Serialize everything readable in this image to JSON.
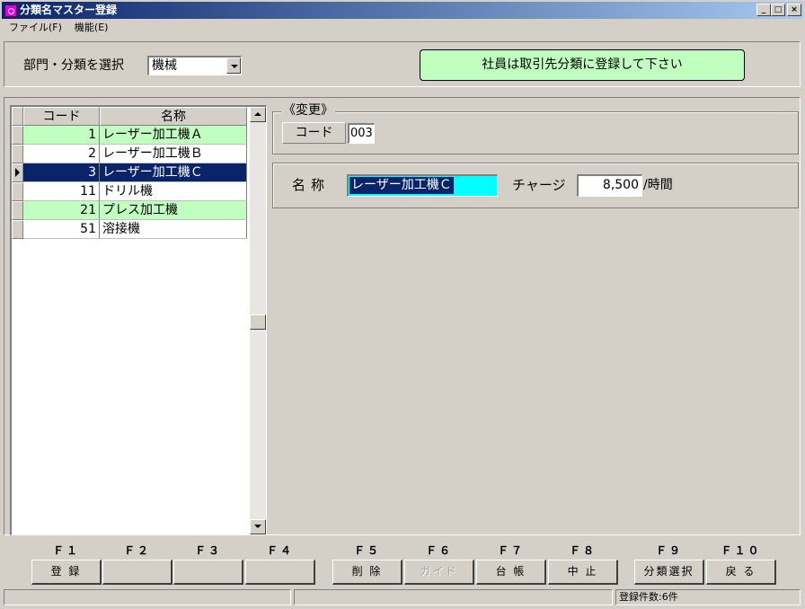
{
  "window": {
    "title": "分類名マスター登録",
    "controls": {
      "minimize": "_",
      "maximize": "□",
      "close": "×"
    }
  },
  "menu": [
    "ファイル(F)",
    "機能(E)"
  ],
  "filter": {
    "label": "部門・分類を選択",
    "selected": "機械"
  },
  "notice": "社員は取引先分類に登録して下さい",
  "grid": {
    "headers": {
      "code": "コード",
      "name": "名称"
    },
    "rows": [
      {
        "code": "1",
        "name": "レーザー加工機Ａ",
        "style": "green"
      },
      {
        "code": "2",
        "name": "レーザー加工機Ｂ",
        "style": "white"
      },
      {
        "code": "3",
        "name": "レーザー加工機Ｃ",
        "style": "selected"
      },
      {
        "code": "11",
        "name": "ドリル機",
        "style": "white"
      },
      {
        "code": "21",
        "name": "プレス加工機",
        "style": "green"
      },
      {
        "code": "51",
        "name": "溶接機",
        "style": "white"
      }
    ]
  },
  "edit": {
    "group_label": "《変更》",
    "code_label": "コード",
    "code_value": "003",
    "name_label": "名称",
    "name_value": "レーザー加工機Ｃ",
    "charge_label": "チャージ",
    "charge_value": "8,500",
    "charge_unit": "/時間"
  },
  "fkeys": [
    {
      "key": "Ｆ１",
      "label": "登 録",
      "enabled": true
    },
    {
      "key": "Ｆ２",
      "label": "",
      "enabled": true
    },
    {
      "key": "Ｆ３",
      "label": "",
      "enabled": true
    },
    {
      "key": "Ｆ４",
      "label": "",
      "enabled": true
    },
    {
      "key": "Ｆ５",
      "label": "削 除",
      "enabled": true
    },
    {
      "key": "Ｆ６",
      "label": "ガイド",
      "enabled": false
    },
    {
      "key": "Ｆ７",
      "label": "台 帳",
      "enabled": true
    },
    {
      "key": "Ｆ８",
      "label": "中 止",
      "enabled": true
    },
    {
      "key": "Ｆ９",
      "label": "分類選択",
      "enabled": true
    },
    {
      "key": "Ｆ１０",
      "label": "戻 る",
      "enabled": true
    }
  ],
  "status": {
    "left": "",
    "middle": "",
    "right": "登録件数:6件"
  },
  "colors": {
    "title_start": "#0a246a",
    "title_end": "#a6caf0",
    "highlight_green": "#c0ffc0",
    "selection": "#0a246a",
    "name_field": "#00ffff"
  }
}
